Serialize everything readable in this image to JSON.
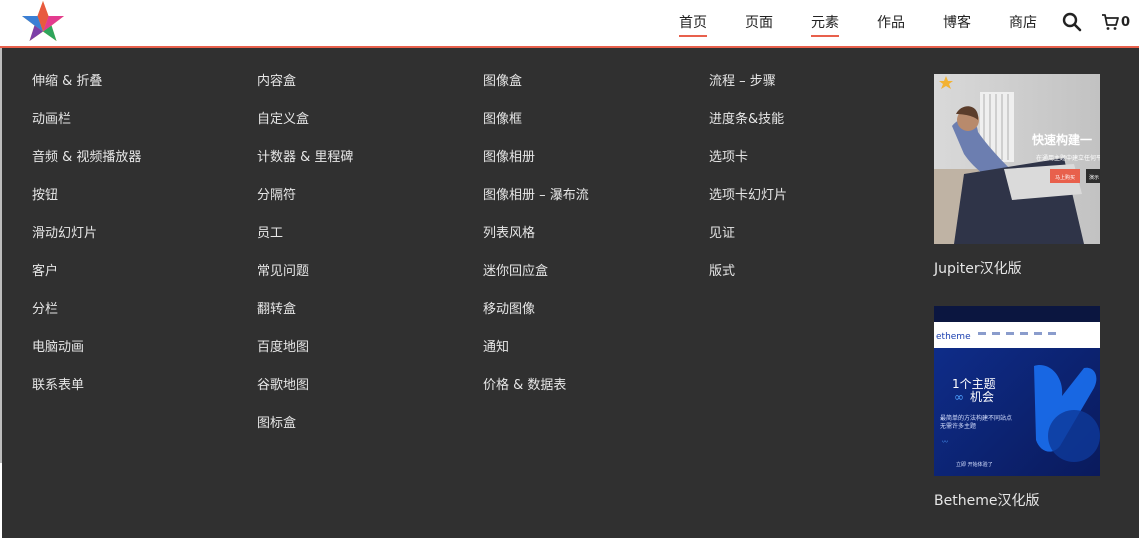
{
  "colors": {
    "accent": "#e8604c",
    "menu_bg": "#303030",
    "menu_text": "#e6e6e6"
  },
  "nav": {
    "items": [
      {
        "label": "首页",
        "active": true
      },
      {
        "label": "页面",
        "active": false
      },
      {
        "label": "元素",
        "active": true
      },
      {
        "label": "作品",
        "active": false
      },
      {
        "label": "博客",
        "active": false
      },
      {
        "label": "商店",
        "active": false
      }
    ],
    "search_icon": "search-icon",
    "cart_icon": "cart-icon",
    "cart_count": "0"
  },
  "menu": {
    "columns": [
      [
        "伸缩 & 折叠",
        "动画栏",
        "音频 & 视频播放器",
        "按钮",
        "滑动幻灯片",
        "客户",
        "分栏",
        "电脑动画",
        "联系表单"
      ],
      [
        "内容盒",
        "自定义盒",
        "计数器 & 里程碑",
        "分隔符",
        "员工",
        "常见问题",
        "翻转盒",
        "百度地图",
        "谷歌地图",
        "图标盒"
      ],
      [
        "图像盒",
        "图像框",
        "图像相册",
        "图像相册 – 瀑布流",
        "列表风格",
        "迷你回应盒",
        "移动图像",
        "通知",
        "价格 & 数据表"
      ],
      [
        "流程 – 步骤",
        "进度条&技能",
        "选项卡",
        "选项卡幻灯片",
        "见证",
        "版式"
      ]
    ]
  },
  "promos": [
    {
      "title": "Jupiter汉化版",
      "image": {
        "headline": "快速构建一",
        "subline": "在通用主题中建立任何平",
        "button1": "马上购买",
        "button2": "演示"
      }
    },
    {
      "title": "Betheme汉化版",
      "image": {
        "brand": "etheme",
        "headline_line1": "1个主题",
        "headline_line2": "机会",
        "infinity": "∞",
        "desc_line1": "最简单的方法构建不同站点",
        "desc_line2": "无需许多主题",
        "cta": "立即 开始体验了"
      }
    }
  ]
}
